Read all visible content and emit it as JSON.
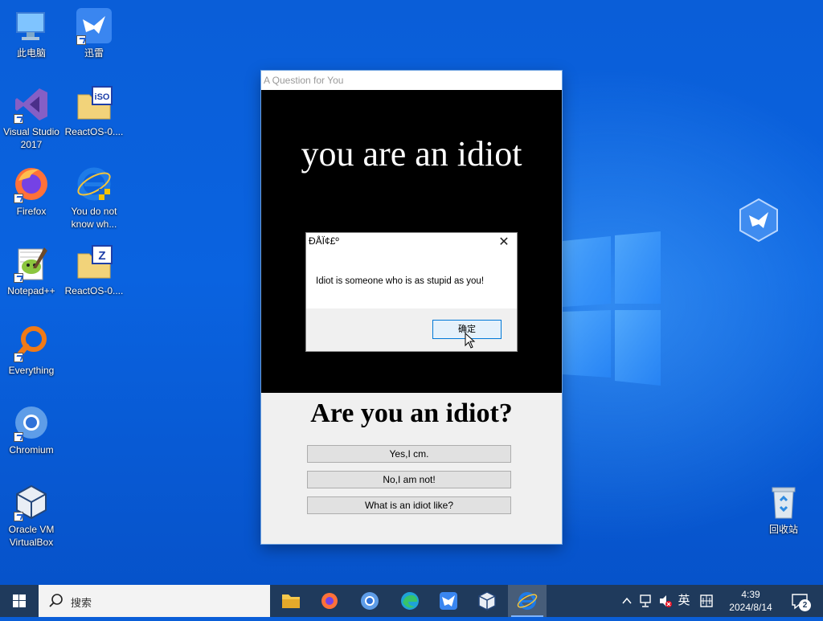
{
  "desktop": {
    "icons": [
      {
        "label": "此电脑"
      },
      {
        "label": "迅雷"
      },
      {
        "label": "Visual Studio 2017"
      },
      {
        "label": "ReactOS-0...."
      },
      {
        "label": "Firefox"
      },
      {
        "label": "You do not know wh..."
      },
      {
        "label": "Notepad++"
      },
      {
        "label": "ReactOS-0...."
      },
      {
        "label": "Everything"
      },
      {
        "label": "Chromium"
      },
      {
        "label": "Oracle VM VirtualBox"
      },
      {
        "label": "回收站"
      }
    ]
  },
  "app_window": {
    "title": "A Question for You",
    "headline": "you are an idiot",
    "question": "Are you an idiot?",
    "buttons": [
      "Yes,I cm.",
      "No,I am not!",
      "What is an idiot like?"
    ]
  },
  "message_box": {
    "title": "ÐÅÏ¢£º",
    "text": "Idiot is someone who is as stupid as you!",
    "ok_label": "确定"
  },
  "taskbar": {
    "search_placeholder": "搜索",
    "ime": "英",
    "time": "4:39",
    "date": "2024/8/14",
    "notification_count": "2"
  },
  "colors": {
    "desktop_blue": "#0a63e0",
    "taskbar": "#1f3a5c",
    "accent": "#0078d7"
  }
}
